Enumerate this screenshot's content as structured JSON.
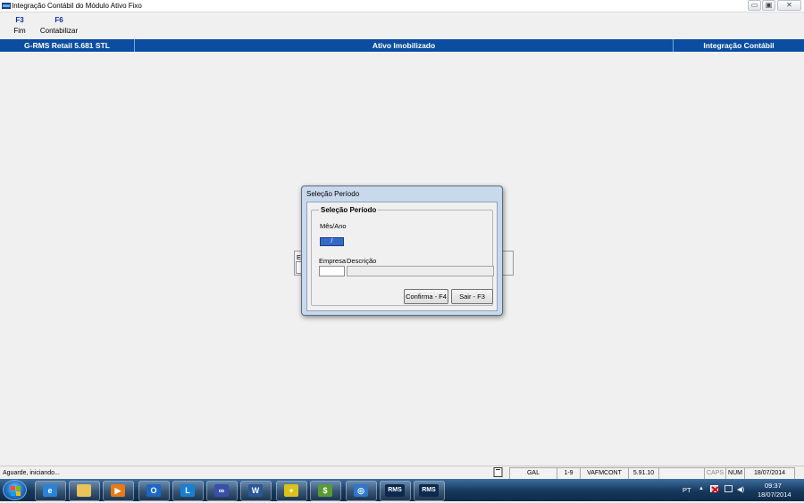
{
  "window": {
    "title": "Integração Contábil do Módulo Ativo Fixo",
    "controls": {
      "minimize": "▭",
      "maximize": "▣",
      "close": "✕"
    }
  },
  "function_keys": [
    {
      "key": "F3",
      "label": "Fim"
    },
    {
      "key": "F6",
      "label": "Contabilizar"
    }
  ],
  "header": {
    "left": "G-RMS Retail 5.681 STL",
    "center": "Ativo Imobilizado",
    "right": "Integração Contábil"
  },
  "background_form": {
    "label_fragment": "Er"
  },
  "dialog": {
    "title": "Seleção Período",
    "group_title": "Seleção Período",
    "mes_ano": {
      "label": "Mês/Ano",
      "value": "/"
    },
    "empresa": {
      "label": "Empresa",
      "value": ""
    },
    "descricao": {
      "label": "Descrição",
      "value": ""
    },
    "buttons": {
      "confirm": "Confirma - F4",
      "exit": "Sair - F3"
    }
  },
  "statusbar": {
    "message": "Aguarde, iniciando...",
    "fields": [
      "GAL",
      "1-9",
      "VAFMCONT",
      "5.91.10",
      "",
      "CAPS",
      "NUM",
      "18/07/2014"
    ]
  },
  "taskbar": {
    "apps": [
      {
        "icon": "internet-explorer-icon",
        "glyph": "e",
        "color": "#2a83d6"
      },
      {
        "icon": "file-explorer-icon",
        "glyph": "",
        "color": "#e9c25a"
      },
      {
        "icon": "media-player-icon",
        "glyph": "▶",
        "color": "#e87a16"
      },
      {
        "icon": "outlook-icon",
        "glyph": "O",
        "color": "#1f66c2"
      },
      {
        "icon": "lync-icon",
        "glyph": "L",
        "color": "#1b7fd0"
      },
      {
        "icon": "network-app-icon",
        "glyph": "∞",
        "color": "#3a4fa8"
      },
      {
        "icon": "word-icon",
        "glyph": "W",
        "color": "#2b5797"
      },
      {
        "icon": "health-app-icon",
        "glyph": "+",
        "color": "#d9c21a"
      },
      {
        "icon": "money-app-icon",
        "glyph": "$",
        "color": "#5a9a35"
      },
      {
        "icon": "globe-app-icon",
        "glyph": "◎",
        "color": "#2f77c9"
      },
      {
        "icon": "rms-app-icon",
        "glyph": "RMS",
        "color": "#0d2a4e"
      },
      {
        "icon": "rms-app-icon-2",
        "glyph": "RMS",
        "color": "#0d2a4e"
      }
    ],
    "language": "PT",
    "time": "09:37",
    "date": "18/07/2014"
  }
}
